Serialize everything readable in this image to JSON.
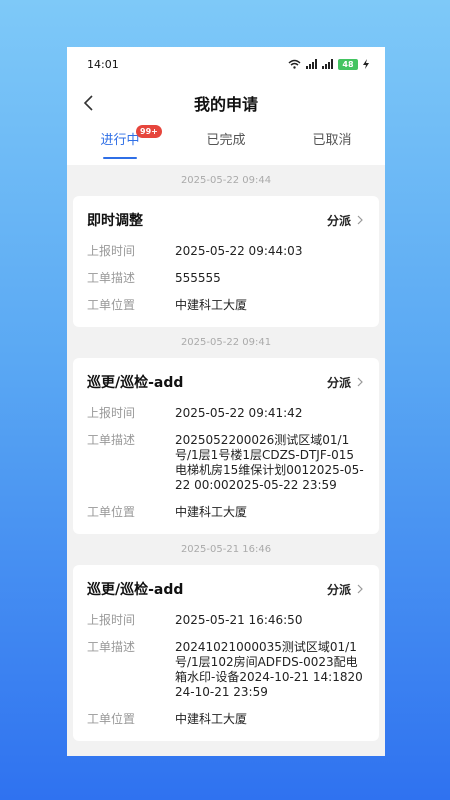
{
  "status": {
    "time": "14:01",
    "battery": "48"
  },
  "header": {
    "title": "我的申请"
  },
  "tabs": [
    {
      "label": "进行中",
      "badge": "99+"
    },
    {
      "label": "已完成"
    },
    {
      "label": "已取消"
    }
  ],
  "field_labels": {
    "report_time": "上报时间",
    "description": "工单描述",
    "location": "工单位置"
  },
  "orders": [
    {
      "date": "2025-05-22 09:44",
      "title": "即时调整",
      "action": "分派",
      "report_time": "2025-05-22 09:44:03",
      "description": "555555",
      "location": "中建科工大厦"
    },
    {
      "date": "2025-05-22 09:41",
      "title": "巡更/巡检-add",
      "action": "分派",
      "report_time": "2025-05-22 09:41:42",
      "description": "2025052200026测试区域01/1号/1层1号楼1层CDZS-DTJF-015电梯机房15维保计划0012025-05-22 00:002025-05-22 23:59",
      "location": "中建科工大厦"
    },
    {
      "date": "2025-05-21 16:46",
      "title": "巡更/巡检-add",
      "action": "分派",
      "report_time": "2025-05-21 16:46:50",
      "description": "20241021000035测试区域01/1号/1层102房间ADFDS-0023配电箱水印-设备2024-10-21 14:182024-10-21 23:59",
      "location": "中建科工大厦"
    }
  ]
}
